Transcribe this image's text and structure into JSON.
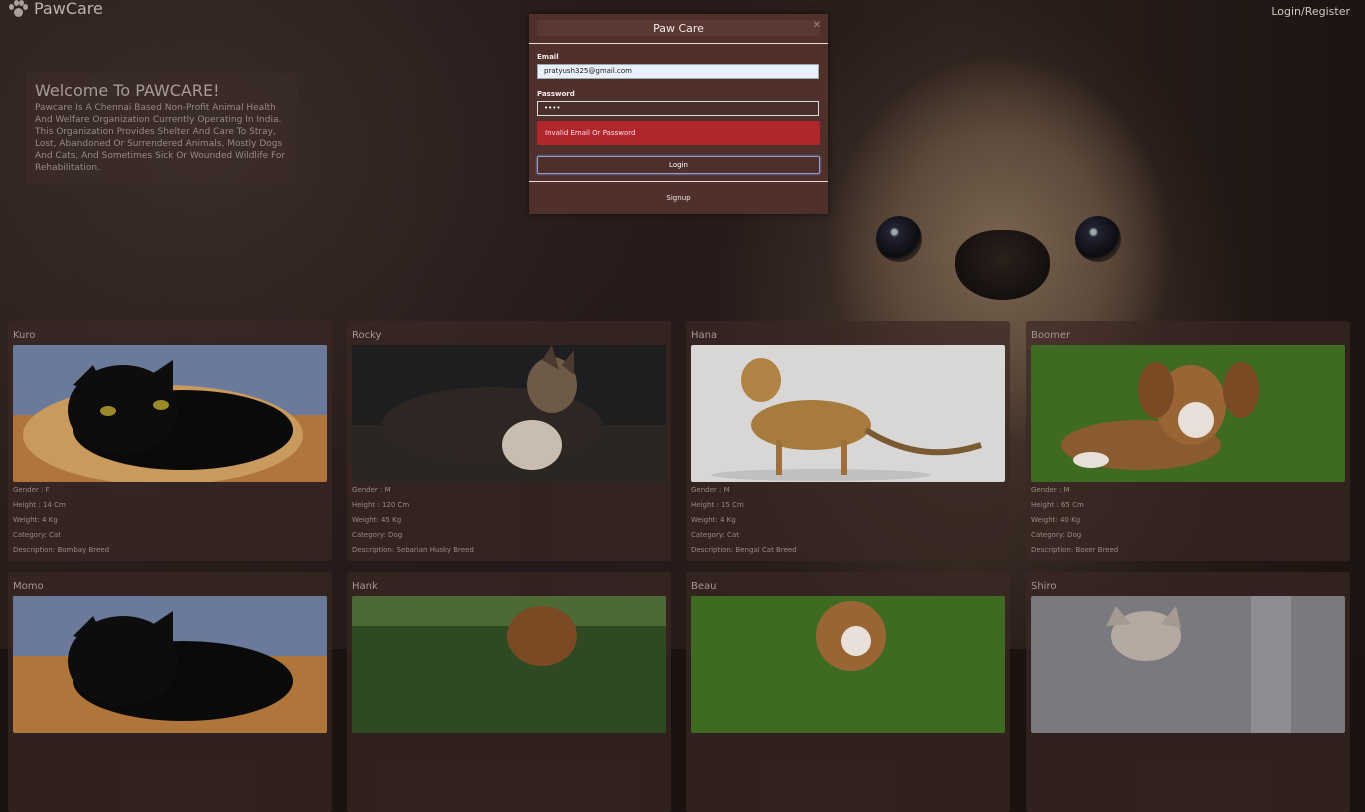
{
  "header": {
    "brand": "PawCare",
    "nav_login": "Login/Register"
  },
  "welcome": {
    "title": "Welcome To PAWCARE!",
    "text": "Pawcare Is A Chennai Based Non-Profit Animal Health And Welfare Organization Currently Operating In India. This Organization Provides Shelter And Care To Stray, Lost, Abandoned Or Surrendered Animals, Mostly Dogs And Cats, And Sometimes Sick Or Wounded Wildlife For Rehabilitation."
  },
  "pets": [
    {
      "name": "Kuro",
      "gender": "Gender : F",
      "height": "Height : 14 Cm",
      "weight": "Weight: 4 Kg",
      "category": "Category: Cat",
      "description": "Description: Bombay Breed"
    },
    {
      "name": "Rocky",
      "gender": "Gender : M",
      "height": "Height : 120 Cm",
      "weight": "Weight: 45 Kg",
      "category": "Category: Dog",
      "description": "Description: Sebarian Husky Breed"
    },
    {
      "name": "Hana",
      "gender": "Gender : M",
      "height": "Height : 15 Cm",
      "weight": "Weight: 4 Kg",
      "category": "Category: Cat",
      "description": "Description: Bengal Cat Breed"
    },
    {
      "name": "Boomer",
      "gender": "Gender : M",
      "height": "Height : 65 Cm",
      "weight": "Weight: 40 Kg",
      "category": "Category: Dog",
      "description": "Description: Boxer Breed"
    },
    {
      "name": "Momo"
    },
    {
      "name": "Hank"
    },
    {
      "name": "Beau"
    },
    {
      "name": "Shiro"
    }
  ],
  "modal": {
    "title": "Paw Care",
    "email_label": "Email",
    "email_value": "pratyush325@gmail.com",
    "password_label": "Password",
    "password_value": "••••",
    "error": "Invalid Email Or Password",
    "login_button": "Login",
    "signup_button": "Signup"
  }
}
